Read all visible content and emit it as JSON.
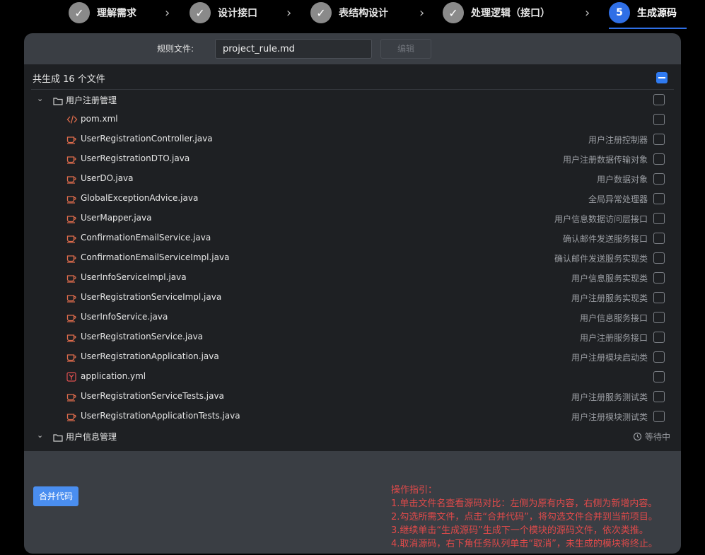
{
  "steps": [
    {
      "label": "理解需求",
      "icon": "check-icon"
    },
    {
      "label": "设计接口",
      "icon": "check-icon"
    },
    {
      "label": "表结构设计",
      "icon": "check-icon"
    },
    {
      "label": "处理逻辑（接口）",
      "icon": "check-icon"
    },
    {
      "label": "生成源码",
      "number": "5"
    }
  ],
  "rule": {
    "label": "规则文件:",
    "value": "project_rule.md",
    "edit_label": "编辑"
  },
  "list": {
    "header": "共生成 16 个文件",
    "group1": {
      "name": "用户注册管理",
      "files": [
        {
          "name": "pom.xml",
          "desc": "",
          "icon": "xml-icon"
        },
        {
          "name": "UserRegistrationController.java",
          "desc": "用户注册控制器",
          "icon": "java-icon"
        },
        {
          "name": "UserRegistrationDTO.java",
          "desc": "用户注册数据传输对象",
          "icon": "java-icon"
        },
        {
          "name": "UserDO.java",
          "desc": "用户数据对象",
          "icon": "java-icon"
        },
        {
          "name": "GlobalExceptionAdvice.java",
          "desc": "全局异常处理器",
          "icon": "java-icon"
        },
        {
          "name": "UserMapper.java",
          "desc": "用户信息数据访问层接口",
          "icon": "java-icon"
        },
        {
          "name": "ConfirmationEmailService.java",
          "desc": "确认邮件发送服务接口",
          "icon": "java-icon"
        },
        {
          "name": "ConfirmationEmailServiceImpl.java",
          "desc": "确认邮件发送服务实现类",
          "icon": "java-icon"
        },
        {
          "name": "UserInfoServiceImpl.java",
          "desc": "用户信息服务实现类",
          "icon": "java-icon"
        },
        {
          "name": "UserRegistrationServiceImpl.java",
          "desc": "用户注册服务实现类",
          "icon": "java-icon"
        },
        {
          "name": "UserInfoService.java",
          "desc": "用户信息服务接口",
          "icon": "java-icon"
        },
        {
          "name": "UserRegistrationService.java",
          "desc": "用户注册服务接口",
          "icon": "java-icon"
        },
        {
          "name": "UserRegistrationApplication.java",
          "desc": "用户注册模块启动类",
          "icon": "java-icon"
        },
        {
          "name": "application.yml",
          "desc": "",
          "icon": "yaml-icon"
        },
        {
          "name": "UserRegistrationServiceTests.java",
          "desc": "用户注册服务测试类",
          "icon": "java-icon"
        },
        {
          "name": "UserRegistrationApplicationTests.java",
          "desc": "用户注册模块测试类",
          "icon": "java-icon"
        }
      ]
    },
    "group2": {
      "name": "用户信息管理",
      "status": "等待中"
    }
  },
  "actions": {
    "merge_label": "合并代码"
  },
  "guide": {
    "title": "操作指引：",
    "lines": [
      "1.单击文件名查看源码对比：左侧为原有内容，右侧为新增内容。",
      "2.勾选所需文件，点击“合并代码”，将勾选文件合并到当前项目。",
      "3.继续单击“生成源码”生成下一个模块的源码文件，依次类推。",
      "4.取消源码，右下角任务队列单击“取消”，未生成的模块将终止。"
    ]
  },
  "colors": {
    "accent": "#2f6fe6",
    "guide_text": "#e04a4a",
    "java_icon": "#e06c4c",
    "yaml_icon": "#e05050"
  }
}
